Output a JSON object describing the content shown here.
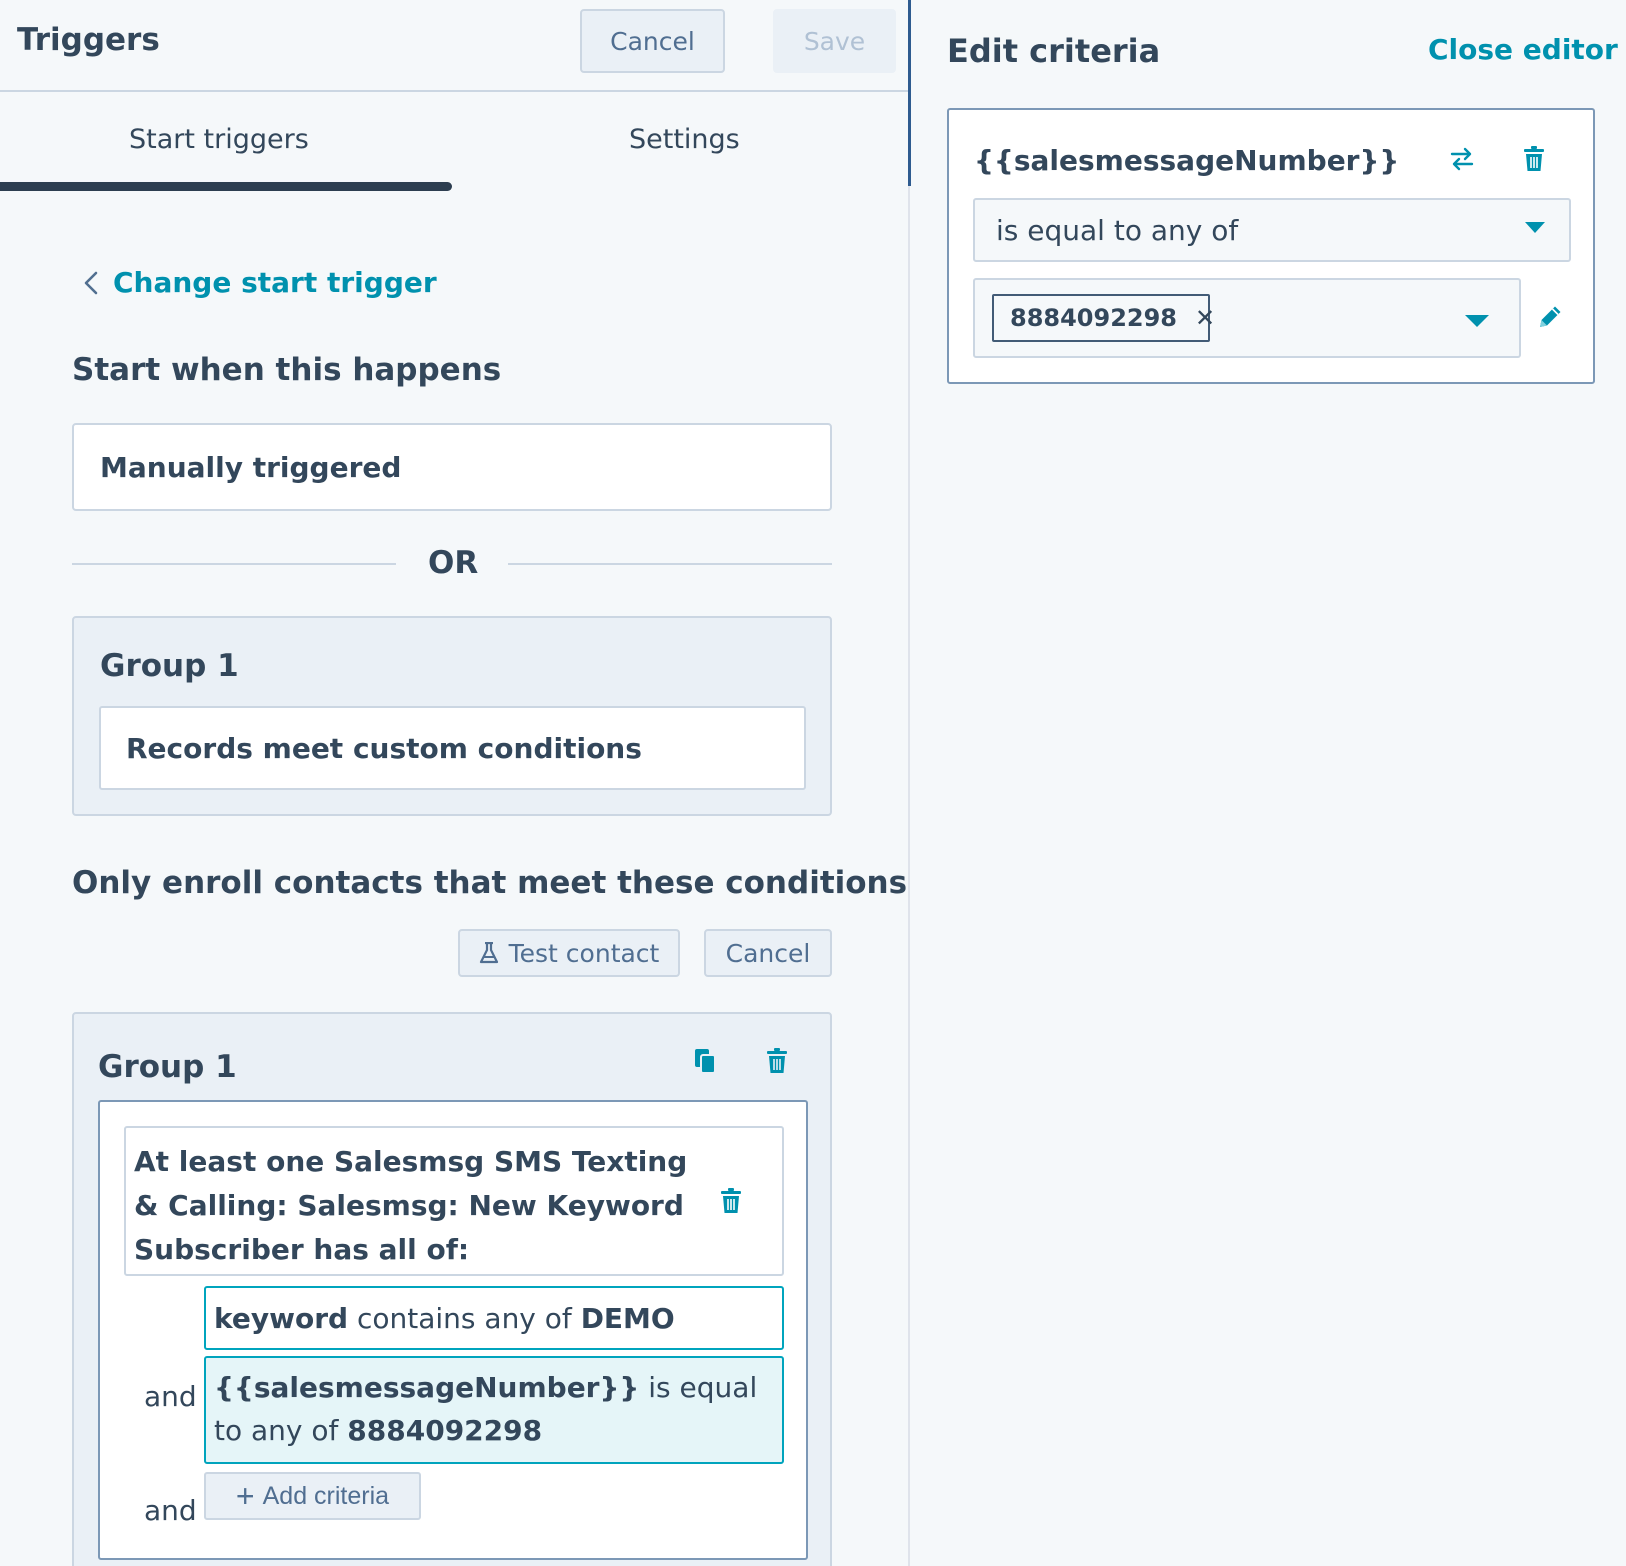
{
  "header": {
    "title": "Triggers",
    "cancel_label": "Cancel",
    "save_label": "Save"
  },
  "tabs": [
    {
      "label": "Start triggers",
      "active": true
    },
    {
      "label": "Settings",
      "active": false
    }
  ],
  "change_trigger_label": "Change start trigger",
  "start_heading": "Start when this happens",
  "manual_trigger": "Manually triggered",
  "or_label": "OR",
  "trigger_group": {
    "title": "Group 1",
    "item": "Records meet custom conditions"
  },
  "enroll_heading": "Only enroll contacts that meet these conditions",
  "test_contact_label": "Test contact",
  "cancel_mid_label": "Cancel",
  "enroll_group": {
    "title": "Group 1",
    "subscriber_text": "At least one Salesmsg SMS Texting & Calling: Salesmsg: New Keyword Subscriber has all of:",
    "criteria": [
      {
        "property": "keyword",
        "operator": "contains any of",
        "value": "DEMO"
      },
      {
        "connector": "and",
        "property": "{{salesmessageNumber}}",
        "operator": "is equal to any of",
        "value": "8884092298"
      }
    ],
    "and_label": "and",
    "add_criteria_label": "Add criteria"
  },
  "editor": {
    "title": "Edit criteria",
    "close_label": "Close editor",
    "property_name": "{{salesmessageNumber}}",
    "operator_selected": "is equal to any of",
    "value_tag": "8884092298"
  },
  "colors": {
    "accent": "#0091ae",
    "text": "#33475b",
    "border": "#cbd6e2",
    "highlight_border": "#00a4bd",
    "highlight_bg": "#e5f5f8"
  }
}
